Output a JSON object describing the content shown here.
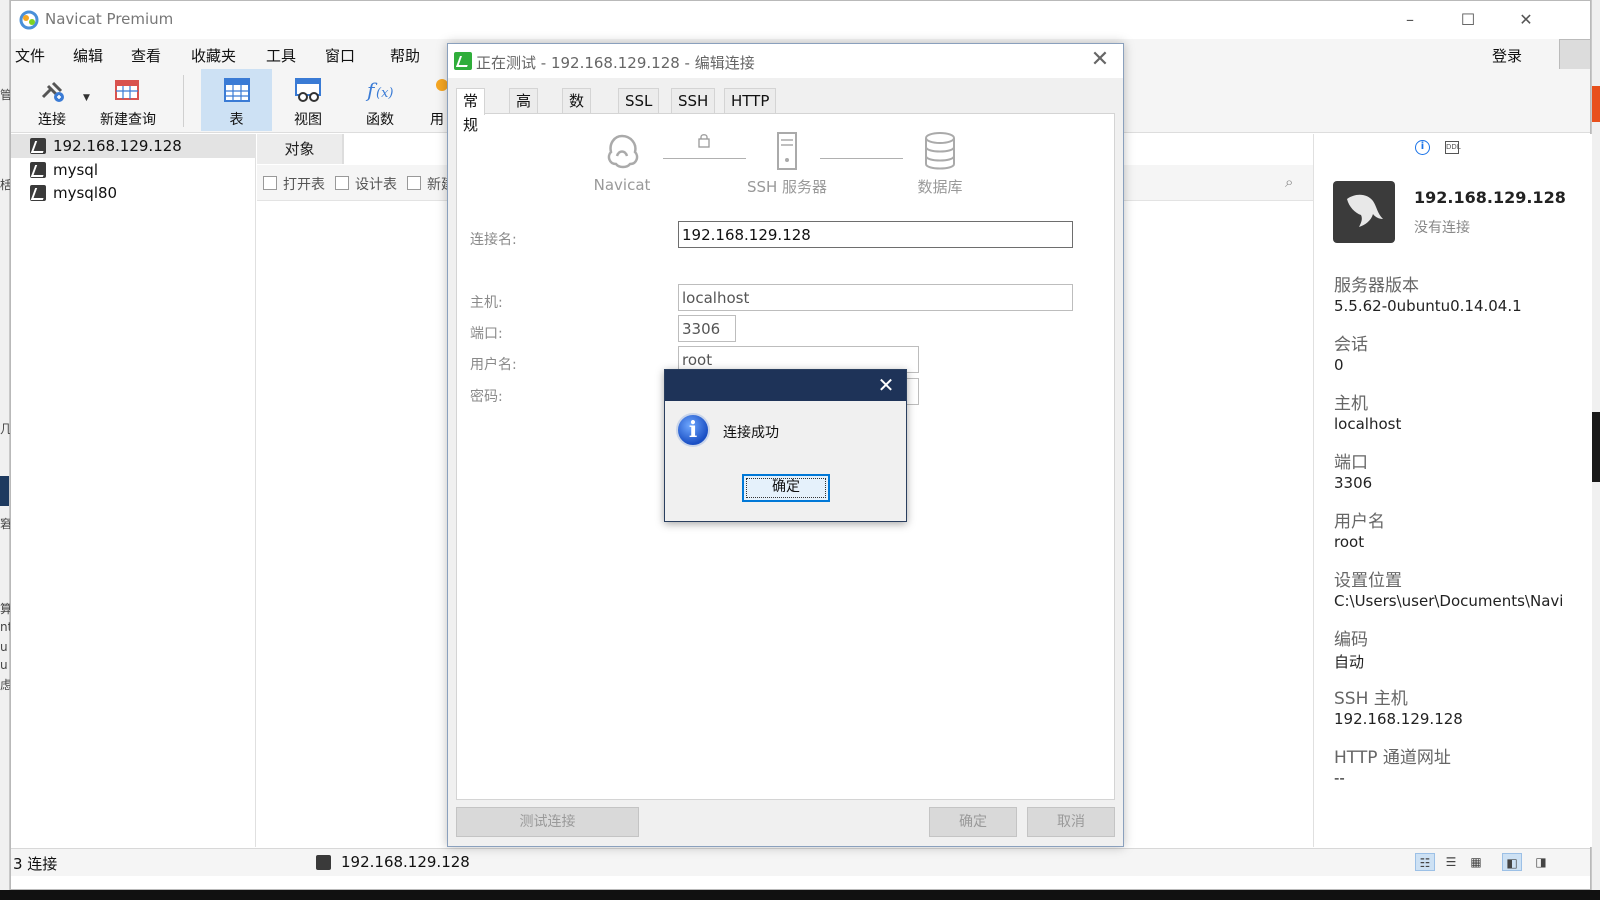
{
  "window": {
    "title": "Navicat Premium",
    "controls": [
      "–",
      "☐",
      "✕"
    ]
  },
  "menu": {
    "items": [
      "文件",
      "编辑",
      "查看",
      "收藏夹",
      "工具",
      "窗口",
      "帮助"
    ],
    "login": "登录"
  },
  "toolbar": {
    "buttons": [
      {
        "label": "连接",
        "icon": "plug-icon"
      },
      {
        "label": "新建查询",
        "icon": "new-query-icon"
      },
      {
        "label": "表",
        "icon": "table-icon"
      },
      {
        "label": "视图",
        "icon": "view-icon"
      },
      {
        "label": "函数",
        "icon": "function-icon"
      },
      {
        "label": "用",
        "icon": "user-icon"
      }
    ]
  },
  "sidebar": {
    "connections": [
      "192.168.129.128",
      "mysql",
      "mysql80"
    ]
  },
  "objects": {
    "tab": "对象",
    "actions": [
      "打开表",
      "设计表",
      "新建"
    ]
  },
  "info": {
    "name": "192.168.129.128",
    "status": "没有连接",
    "fields": [
      {
        "label": "服务器版本",
        "value": "5.5.62-0ubuntu0.14.04.1"
      },
      {
        "label": "会话",
        "value": "0"
      },
      {
        "label": "主机",
        "value": "localhost"
      },
      {
        "label": "端口",
        "value": "3306"
      },
      {
        "label": "用户名",
        "value": "root"
      },
      {
        "label": "设置位置",
        "value": "C:\\Users\\user\\Documents\\Navi"
      },
      {
        "label": "编码",
        "value": "自动"
      },
      {
        "label": "SSH 主机",
        "value": "192.168.129.128"
      },
      {
        "label": "HTTP 通道网址",
        "value": "--"
      }
    ]
  },
  "statusbar": {
    "count": "3 连接",
    "current": "192.168.129.128"
  },
  "dialog": {
    "title": "正在测试 - 192.168.129.128 - 编辑连接",
    "tabs": [
      "常规",
      "高级",
      "数据库",
      "SSL",
      "SSH",
      "HTTP"
    ],
    "flow": {
      "navicat": "Navicat",
      "ssh": "SSH 服务器",
      "db": "数据库"
    },
    "fields": {
      "conn_name_label": "连接名:",
      "conn_name_value": "192.168.129.128",
      "host_label": "主机:",
      "host_value": "localhost",
      "port_label": "端口:",
      "port_value": "3306",
      "user_label": "用户名:",
      "user_value": "root",
      "password_label": "密码:"
    },
    "buttons": {
      "test": "测试连接",
      "ok": "确定",
      "cancel": "取消"
    }
  },
  "message": {
    "text": "连接成功",
    "ok": "确定",
    "icon": "info-icon"
  },
  "colors": {
    "accent": "#cde1f4",
    "message_title": "#1e3358",
    "dialog_icon": "#2fae3a"
  }
}
